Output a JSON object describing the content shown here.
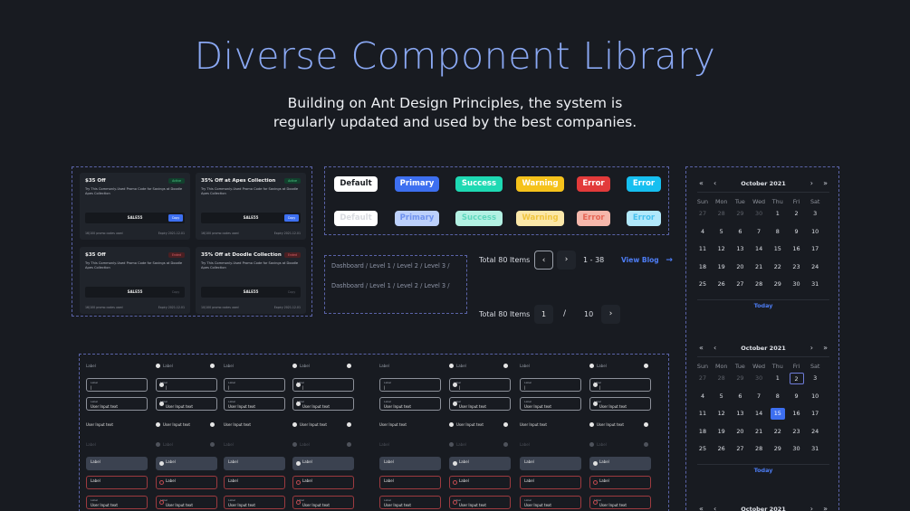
{
  "header": {
    "title": "Diverse Component Library",
    "subtitle_line1": "Building on Ant Design Principles, the system is",
    "subtitle_line2": "regularly updated and used by the best companies."
  },
  "promo_cards": [
    {
      "title": "$35 Off",
      "desc": "Try This Commonly-Used Promo Code for Savings at Doodle Apes Collection",
      "badge": "Active",
      "code": "SALE55",
      "copy": "Copy",
      "used": "16/100 promo codes used",
      "expiry": "Expiry 2021.12.01"
    },
    {
      "title": "35% Off at Apes Collection",
      "desc": "Try This Commonly-Used Promo Code for Savings at Doodle Apes Collection",
      "badge": "Active",
      "code": "SALE55",
      "copy": "Copy",
      "used": "16/100 promo codes used",
      "expiry": "Expiry 2021.12.01"
    },
    {
      "title": "$35 Off",
      "desc": "Try This Commonly-Used Promo Code for Savings at Doodle Apes Collection",
      "badge": "Ended",
      "code": "SALE55",
      "copy": "Copy",
      "used": "16/100 promo codes used",
      "expiry": "Expiry 2021.12.01"
    },
    {
      "title": "35% Off at Doodle Collection",
      "desc": "Try This Commonly-Used Promo Code for Savings at Doodle Apes Collection",
      "badge": "Ended",
      "code": "SALE55",
      "copy": "Copy",
      "used": "10/100 promo codes used",
      "expiry": "Expiry 2021.12.01"
    }
  ],
  "buttons": {
    "default": "Default",
    "primary": "Primary",
    "success": "Success",
    "warning": "Warning",
    "error": "Error",
    "error2": "Error"
  },
  "colors": {
    "primary": "#3d6ff0",
    "success": "#1ed9b3",
    "warning": "#f5c21b",
    "error": "#e23a3a",
    "cyan": "#16bff0",
    "default": "#ffffff"
  },
  "breadcrumb": {
    "line1": "Dashboard / Level 1 / Level 2 / Level 3 /",
    "line2": "Dashboard / Level 1 / Level 2 / Level 3 /"
  },
  "pagination": {
    "total1": "Total 80 Items",
    "range": "1 - 38",
    "view_blog": "View Blog",
    "total2": "Total 80 Items",
    "page": "1",
    "slash": "/",
    "pages": "10"
  },
  "calendar": {
    "month": "October 2021",
    "weekdays": [
      "Sun",
      "Mon",
      "Tue",
      "Wed",
      "Thu",
      "Fri",
      "Sat"
    ],
    "today": "Today",
    "days": [
      "27",
      "28",
      "29",
      "30",
      "1",
      "2",
      "3",
      "4",
      "5",
      "6",
      "7",
      "8",
      "9",
      "10",
      "11",
      "12",
      "13",
      "14",
      "15",
      "16",
      "17",
      "18",
      "19",
      "20",
      "21",
      "22",
      "23",
      "24",
      "25",
      "26",
      "27",
      "28",
      "29",
      "30",
      "31"
    ]
  },
  "inputs": {
    "label": "Label",
    "value": "User Input text",
    "value_ph": "User Input text|",
    "small": "Label",
    "cursor": "|"
  }
}
